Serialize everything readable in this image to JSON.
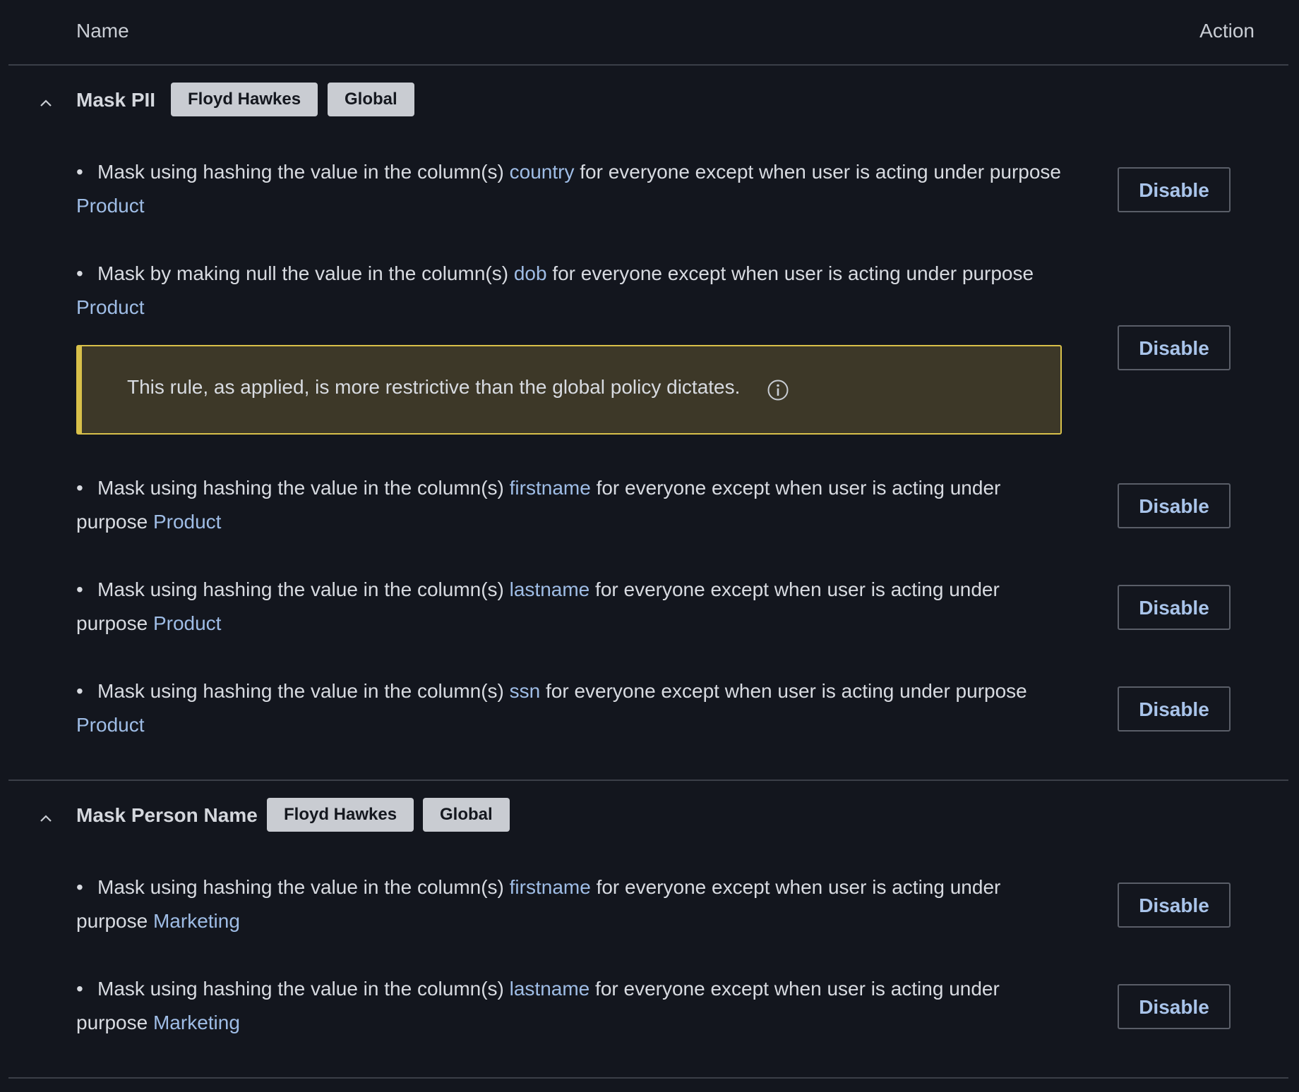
{
  "header": {
    "name_label": "Name",
    "action_label": "Action"
  },
  "policies": [
    {
      "title": "Mask PII",
      "tags": [
        "Floyd Hawkes",
        "Global"
      ],
      "chevron_icon": "chevron-up-icon",
      "rules": [
        {
          "pre": "Mask using hashing the value in the column(s) ",
          "column": "country",
          "mid": " for everyone except when user is acting under purpose ",
          "purpose": "Product",
          "action": "Disable"
        },
        {
          "pre": "Mask by making null the value in the column(s) ",
          "column": "dob",
          "mid": " for everyone except when user is acting under purpose ",
          "purpose": "Product",
          "action": "Disable",
          "warning": "This rule, as applied, is more restrictive than the global policy dictates.",
          "warning_icon": "info-icon"
        },
        {
          "pre": "Mask using hashing the value in the column(s) ",
          "column": "firstname",
          "mid": " for everyone except when user is acting under purpose ",
          "purpose": "Product",
          "action": "Disable"
        },
        {
          "pre": "Mask using hashing the value in the column(s) ",
          "column": "lastname",
          "mid": " for everyone except when user is acting under purpose ",
          "purpose": "Product",
          "action": "Disable"
        },
        {
          "pre": "Mask using hashing the value in the column(s) ",
          "column": "ssn",
          "mid": " for everyone except when user is acting under purpose ",
          "purpose": "Product",
          "action": "Disable"
        }
      ]
    },
    {
      "title": "Mask Person Name",
      "tags": [
        "Floyd Hawkes",
        "Global"
      ],
      "chevron_icon": "chevron-up-icon",
      "rules": [
        {
          "pre": "Mask using hashing the value in the column(s) ",
          "column": "firstname",
          "mid": " for everyone except when user is acting under purpose ",
          "purpose": "Marketing",
          "action": "Disable"
        },
        {
          "pre": "Mask using hashing the value in the column(s) ",
          "column": "lastname",
          "mid": " for everyone except when user is acting under purpose ",
          "purpose": "Marketing",
          "action": "Disable"
        }
      ]
    }
  ],
  "colors": {
    "background": "#13161e",
    "link": "#9fbde6",
    "tag_bg": "#c9ccd2",
    "warning_bg": "#3d3828",
    "warning_border": "#d8c04a"
  }
}
